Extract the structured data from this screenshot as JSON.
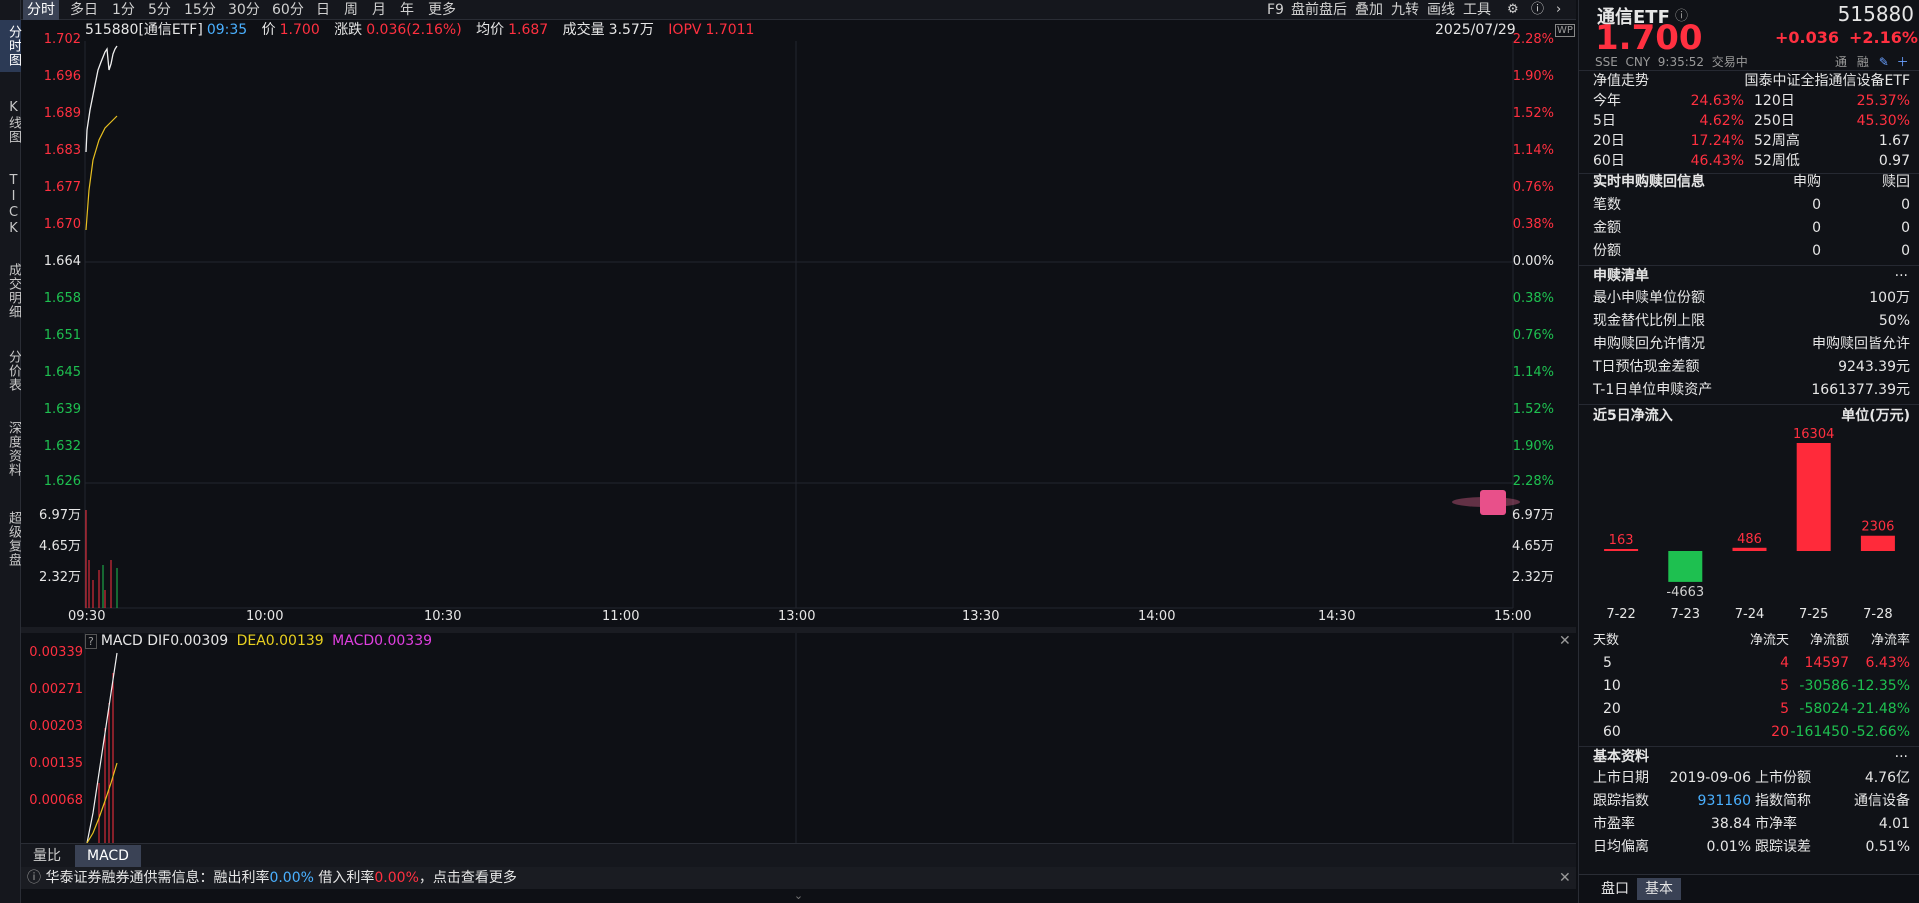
{
  "vtabs": [
    "分时图",
    "K线图",
    "TICK",
    "成交明细",
    "分价表",
    "深度资料",
    "超级复盘"
  ],
  "toolbar": {
    "periods": [
      "分时",
      "多日",
      "1分",
      "5分",
      "15分",
      "30分",
      "60分",
      "日",
      "周",
      "月",
      "年",
      "更多"
    ],
    "right": [
      "F9",
      "盘前盘后",
      "叠加",
      "九转",
      "画线",
      "工具"
    ]
  },
  "info": {
    "code_name": "515880[通信ETF]",
    "time": "09:35",
    "price_label": "价",
    "price": "1.700",
    "change_label": "涨跌",
    "change": "0.036(2.16%)",
    "avg_label": "均价",
    "avg": "1.687",
    "volume_label": "成交量",
    "volume": "3.57万",
    "iopv_label": "IOPV",
    "iopv": "1.7011",
    "date": "2025/07/29"
  },
  "price_axis_left": [
    "1.702",
    "1.696",
    "1.689",
    "1.683",
    "1.677",
    "1.670",
    "1.664",
    "1.658",
    "1.651",
    "1.645",
    "1.639",
    "1.632",
    "1.626"
  ],
  "price_axis_right": [
    "2.28%",
    "1.90%",
    "1.52%",
    "1.14%",
    "0.76%",
    "0.38%",
    "0.00%",
    "0.38%",
    "0.76%",
    "1.14%",
    "1.52%",
    "1.90%",
    "2.28%"
  ],
  "volume_axis": [
    "6.97万",
    "4.65万",
    "2.32万"
  ],
  "time_axis": [
    "09:30",
    "10:00",
    "10:30",
    "11:00",
    "13:00",
    "13:30",
    "14:00",
    "14:30",
    "15:00"
  ],
  "macd": {
    "help": "?",
    "title": "MACD",
    "dif_label": "DIF",
    "dif": "0.00309",
    "dea_label": "DEA",
    "dea": "0.00139",
    "macd_label": "MACD",
    "macd": "0.00339",
    "axis": [
      "0.00339",
      "0.00271",
      "0.00203",
      "0.00135",
      "0.00068"
    ]
  },
  "indicator_tabs": [
    "量比",
    "MACD"
  ],
  "notice": {
    "prefix": "华泰证券融券通供需信息：融出利率",
    "lend_rate": "0.00%",
    "borrow_label": "借入利率",
    "borrow_rate": "0.00%",
    "suffix": "，点击查看更多"
  },
  "right": {
    "name": "通信ETF",
    "code": "515880",
    "price": "1.700",
    "change": "+0.036",
    "change_pct": "+2.16%",
    "exchange": "SSE",
    "currency": "CNY",
    "clock": "9:35:52",
    "status": "交易中",
    "flags": [
      "通",
      "融"
    ],
    "nav_title": "净值走势",
    "fund_full": "国泰中证全指通信设备ETF",
    "returns": [
      {
        "l1": "今年",
        "v1": "24.63%",
        "l2": "120日",
        "v2": "25.37%"
      },
      {
        "l1": "5日",
        "v1": "4.62%",
        "l2": "250日",
        "v2": "45.30%"
      },
      {
        "l1": "20日",
        "v1": "17.24%",
        "l2": "52周高",
        "v2": "1.67"
      },
      {
        "l1": "60日",
        "v1": "46.43%",
        "l2": "52周低",
        "v2": "0.97"
      }
    ],
    "sub_title": "实时申购赎回信息",
    "sub_cols": [
      "申购",
      "赎回"
    ],
    "sub_rows": [
      {
        "label": "笔数",
        "a": "0",
        "b": "0"
      },
      {
        "label": "金额",
        "a": "0",
        "b": "0"
      },
      {
        "label": "份额",
        "a": "0",
        "b": "0"
      }
    ],
    "list_title": "申赎清单",
    "more": "···",
    "list_rows": [
      {
        "label": "最小申赎单位份额",
        "value": "100万"
      },
      {
        "label": "现金替代比例上限",
        "value": "50%"
      },
      {
        "label": "申购赎回允许情况",
        "value": "申购赎回皆允许"
      },
      {
        "label": "T日预估现金差额",
        "value": "9243.39元"
      },
      {
        "label": "T-1日单位申赎资产",
        "value": "1661377.39元"
      }
    ],
    "flow_title": "近5日净流入",
    "flow_unit": "单位(万元)",
    "flow_table_cols": [
      "天数",
      "净流天",
      "净流额",
      "净流率"
    ],
    "flow_table": [
      {
        "days": "5",
        "up": "4",
        "amount": "14597",
        "rate": "6.43%"
      },
      {
        "days": "10",
        "up": "5",
        "amount": "-30586",
        "rate": "-12.35%"
      },
      {
        "days": "20",
        "up": "5",
        "amount": "-58024",
        "rate": "-21.48%"
      },
      {
        "days": "60",
        "up": "20",
        "amount": "-161450",
        "rate": "-52.66%"
      }
    ],
    "basic_title": "基本资料",
    "basic": [
      {
        "l1": "上市日期",
        "v1": "2019-09-06",
        "l2": "上市份额",
        "v2": "4.76亿"
      },
      {
        "l1": "跟踪指数",
        "v1": "931160",
        "l2": "指数简称",
        "v2": "通信设备"
      },
      {
        "l1": "市盈率",
        "v1": "38.84",
        "l2": "市净率",
        "v2": "4.01"
      },
      {
        "l1": "日均偏离",
        "v1": "0.01%",
        "l2": "跟踪误差",
        "v2": "0.51%"
      }
    ],
    "bottom_tabs": [
      "盘口",
      "基本"
    ]
  },
  "chart_data": {
    "type": "bar",
    "title": "近5日净流入",
    "ylabel": "单位(万元)",
    "categories": [
      "7-22",
      "7-23",
      "7-24",
      "7-25",
      "7-28"
    ],
    "values": [
      163,
      -4663,
      486,
      16304,
      2306
    ],
    "colors": {
      "positive": "#ff2a3a",
      "negative": "#1ec050"
    }
  },
  "colors": {
    "up": "#ff3040",
    "down": "#1ec050",
    "bg": "#0e1015",
    "accent": "#2c3a55"
  }
}
